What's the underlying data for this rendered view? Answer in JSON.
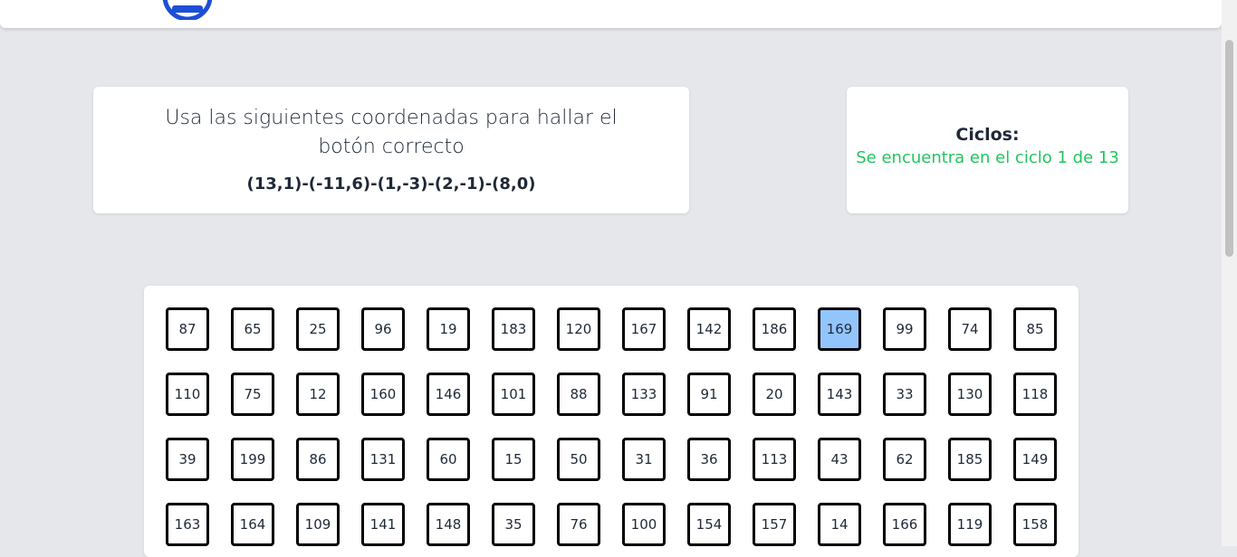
{
  "header": {
    "logo": "logo-icon"
  },
  "instructions": {
    "text": "Usa las siguientes coordenadas para hallar el botón correcto",
    "coordinates": "(13,1)-(-11,6)-(1,-3)-(2,-1)-(8,0)"
  },
  "cycles": {
    "label": "Ciclos:",
    "status": "Se encuentra en el ciclo 1 de 13",
    "status_color": "#22c55e"
  },
  "grid": {
    "selected_value": "169",
    "selected_color": "#93c5fd",
    "rows": [
      [
        "87",
        "65",
        "25",
        "96",
        "19",
        "183",
        "120",
        "167",
        "142",
        "186",
        "169",
        "99",
        "74",
        "85"
      ],
      [
        "110",
        "75",
        "12",
        "160",
        "146",
        "101",
        "88",
        "133",
        "91",
        "20",
        "143",
        "33",
        "130",
        "118"
      ],
      [
        "39",
        "199",
        "86",
        "131",
        "60",
        "15",
        "50",
        "31",
        "36",
        "113",
        "43",
        "62",
        "185",
        "149"
      ],
      [
        "163",
        "164",
        "109",
        "141",
        "148",
        "35",
        "76",
        "100",
        "154",
        "157",
        "14",
        "166",
        "119",
        "158"
      ]
    ]
  }
}
